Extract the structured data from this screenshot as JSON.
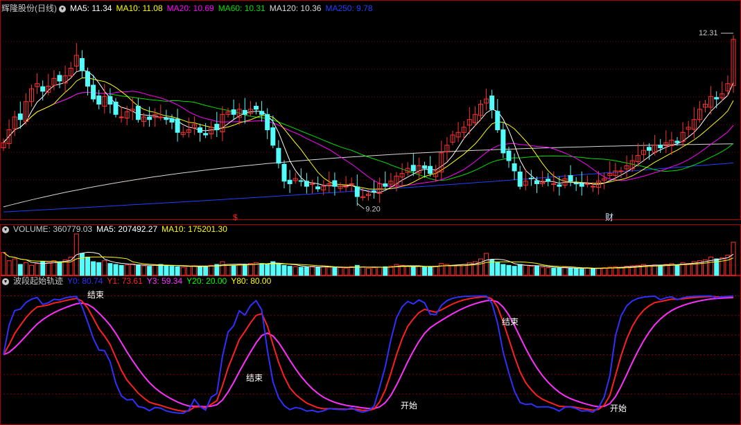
{
  "colors": {
    "bg": "#000000",
    "grid": "#8b0000",
    "panel_border": "#b00000",
    "up": "#ff3232",
    "down": "#54fcfc",
    "ma5": "#ffffff",
    "ma10": "#ffff00",
    "ma20": "#ff00ff",
    "ma60": "#00e000",
    "ma120": "#d8d8d8",
    "ma250": "#2040ff",
    "y0": "#3030ff",
    "y1": "#ff2020",
    "y3": "#ff30ff",
    "y20": "#00ff00",
    "y80": "#ffff00"
  },
  "header": {
    "stock": "辉隆股份(日线)",
    "ma5": "MA5: 11.34",
    "ma10": "MA10: 11.08",
    "ma20": "MA20: 10.69",
    "ma60": "MA60: 10.31",
    "ma120": "MA120: 10.36",
    "ma250": "MA250: 9.78"
  },
  "volume_header": {
    "name": "VOLUME: 360779.03",
    "ma5": "MA5: 207492.27",
    "ma10": "MA10: 175201.30"
  },
  "indicator_header": {
    "name": "波段起始轨迹",
    "y0": "Y0: 80.74",
    "y1": "Y1: 73.61",
    "y3": "Y3: 59.34",
    "y20": "Y20: 20.00",
    "y80": "Y80: 80.00"
  },
  "chart_data": [
    {
      "type": "candlestick",
      "annotations": {
        "high": "12.31",
        "low": "9.20"
      },
      "markers": [
        "$",
        "财"
      ],
      "closes": [
        10.3,
        10.55,
        10.8,
        10.75,
        11.1,
        11.35,
        11.45,
        11.3,
        11.4,
        11.55,
        11.5,
        11.6,
        11.75,
        12.0,
        11.7,
        11.4,
        11.15,
        11.05,
        11.2,
        11.05,
        10.85,
        10.8,
        10.9,
        10.95,
        10.75,
        10.8,
        10.75,
        10.85,
        10.8,
        10.75,
        10.7,
        10.5,
        10.5,
        10.55,
        10.65,
        10.5,
        10.45,
        10.6,
        10.55,
        10.85,
        10.9,
        10.85,
        10.95,
        10.85,
        10.95,
        10.95,
        10.85,
        10.55,
        10.25,
        9.9,
        9.55,
        9.5,
        9.6,
        9.55,
        9.45,
        9.5,
        9.4,
        9.45,
        9.5,
        9.45,
        9.45,
        9.45,
        9.5,
        9.25,
        9.25,
        9.3,
        9.35,
        9.5,
        9.45,
        9.55,
        9.65,
        9.7,
        9.8,
        9.75,
        9.85,
        9.8,
        9.7,
        9.75,
        10.1,
        10.25,
        10.45,
        10.5,
        10.6,
        10.75,
        10.85,
        11.05,
        11.15,
        10.95,
        10.55,
        10.1,
        9.95,
        9.75,
        9.45,
        9.55,
        9.6,
        9.5,
        9.55,
        9.55,
        9.5,
        9.45,
        9.6,
        9.55,
        9.5,
        9.45,
        9.5,
        9.45,
        9.55,
        9.6,
        9.7,
        9.75,
        9.75,
        9.85,
        9.95,
        10.05,
        10.15,
        10.15,
        10.25,
        10.2,
        10.3,
        10.35,
        10.3,
        10.5,
        10.6,
        10.75,
        10.95,
        11.05,
        11.2,
        11.15,
        11.25,
        11.45,
        12.31
      ],
      "volume": [
        250,
        160,
        180,
        120,
        140,
        110,
        130,
        150,
        140,
        160,
        150,
        170,
        200,
        450,
        240,
        200,
        150,
        140,
        160,
        130,
        120,
        110,
        115,
        125,
        110,
        105,
        100,
        110,
        120,
        110,
        100,
        95,
        90,
        100,
        105,
        95,
        100,
        110,
        120,
        150,
        120,
        110,
        115,
        120,
        130,
        140,
        130,
        120,
        150,
        130,
        110,
        100,
        95,
        90,
        90,
        100,
        90,
        95,
        90,
        85,
        85,
        80,
        95,
        110,
        90,
        80,
        85,
        90,
        95,
        100,
        120,
        110,
        100,
        95,
        100,
        90,
        95,
        100,
        130,
        120,
        110,
        115,
        120,
        140,
        150,
        180,
        240,
        170,
        140,
        120,
        110,
        100,
        120,
        110,
        100,
        100,
        90,
        85,
        80,
        80,
        90,
        80,
        75,
        70,
        80,
        75,
        80,
        85,
        90,
        95,
        90,
        100,
        105,
        110,
        120,
        110,
        115,
        110,
        120,
        130,
        115,
        140,
        130,
        150,
        160,
        170,
        200,
        180,
        190,
        220,
        360.78
      ]
    },
    {
      "type": "line",
      "levels": {
        "y20": 20,
        "y80": 80
      },
      "labels": [
        "结束",
        "结束",
        "开始",
        "结束",
        "开始"
      ]
    }
  ]
}
